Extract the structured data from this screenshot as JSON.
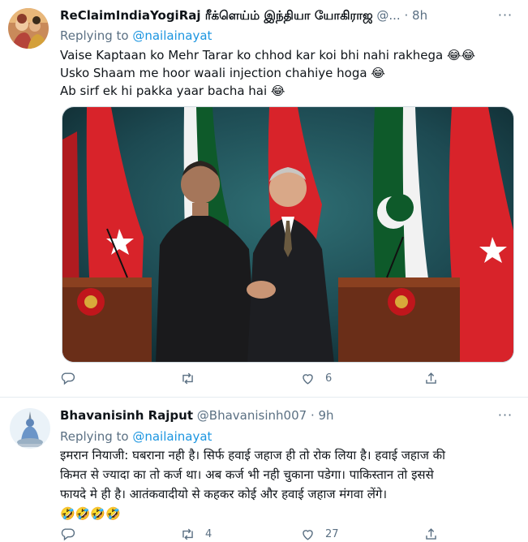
{
  "tweets": [
    {
      "author_name": "ReClaimIndiaYogiRaj ரீக்ளெய்ம் இந்தியா யோகிராஜ",
      "handle": "@...",
      "separator": "·",
      "time": "8h",
      "more_label": "···",
      "replying_prefix": "Replying to",
      "replying_to": "@nailainayat",
      "lines": [
        "Vaise Kaptaan ko Mehr Tarar ko chhod kar koi bhi nahi rakhega 😂😂",
        "Usko Shaam me hoor waali injection chahiye hoga 😂",
        "Ab sirf ek hi pakka yaar bacha hai 😂"
      ],
      "counts": {
        "reply": "",
        "retweet": "",
        "like": "6"
      }
    },
    {
      "author_name": "Bhavanisinh Rajput",
      "handle": "@Bhavanisinh007",
      "separator": "·",
      "time": "9h",
      "more_label": "···",
      "replying_prefix": "Replying to",
      "replying_to": "@nailainayat",
      "lines": [
        "इमरान नियाजी: घबराना नही है। सिर्फ हवाई जहाज ही तो रोक लिया है। हवाई जहाज की",
        "किमत से ज्यादा का तो कर्ज था। अब कर्ज भी नही चुकाना पडेगा। पाकिस्तान तो इससे",
        "फायदे मे ही है। आतंकवादीयो से कहकर कोई और हवाई जहाज मंगवा लेंगे।",
        "🤣🤣🤣🤣"
      ],
      "counts": {
        "reply": "",
        "retweet": "4",
        "like": "27"
      }
    }
  ],
  "colors": {
    "text": "#0f1419",
    "muted": "#5b7083",
    "link": "#1b95e0",
    "divider": "#e6ecf0",
    "turkey_red": "#d8232a",
    "pakistan_green": "#01411c"
  },
  "icons": [
    "more-icon",
    "reply-icon",
    "retweet-icon",
    "like-icon",
    "share-icon"
  ]
}
